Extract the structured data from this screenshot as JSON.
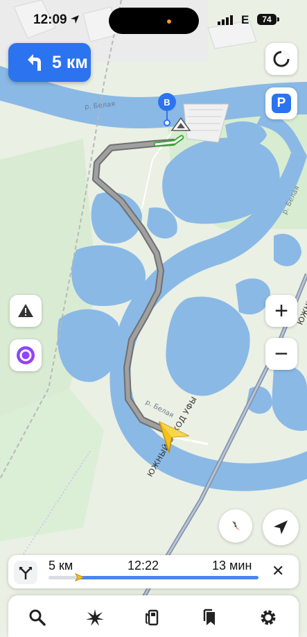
{
  "status_bar": {
    "time": "12:09",
    "carrier": "E",
    "battery": "74"
  },
  "maneuver": {
    "distance": "5 км"
  },
  "map": {
    "river_label_1": "р. Белая",
    "river_label_2": "р. Белая",
    "river_label_3": "р. Белая",
    "road_label_1": "ЮЖНЫЙ ОБХОД УФЫ",
    "road_label_2": "ЮЖНЫ",
    "destination_marker": "B"
  },
  "controls": {
    "zoom_in": "+",
    "zoom_out": "−",
    "parking": "P"
  },
  "route_panel": {
    "distance": "5 км",
    "arrival_time": "12:22",
    "duration": "13 мин",
    "close": "✕",
    "progress": 0.15
  },
  "tabbar": {
    "items": [
      "search",
      "ar-navigation",
      "fuel",
      "bookmarks",
      "settings"
    ]
  },
  "icons": {
    "maneuver": "turn-left-icon",
    "compass_rose": "compass-icon",
    "alert": "road-alert-icon",
    "assistant": "alice-assistant-icon",
    "locate": "navigate-arrow-icon"
  },
  "colors": {
    "accent": "#2c73ef",
    "water": "#8ab9e6",
    "route": "#8e8e8e",
    "car": "#f2c21a"
  }
}
